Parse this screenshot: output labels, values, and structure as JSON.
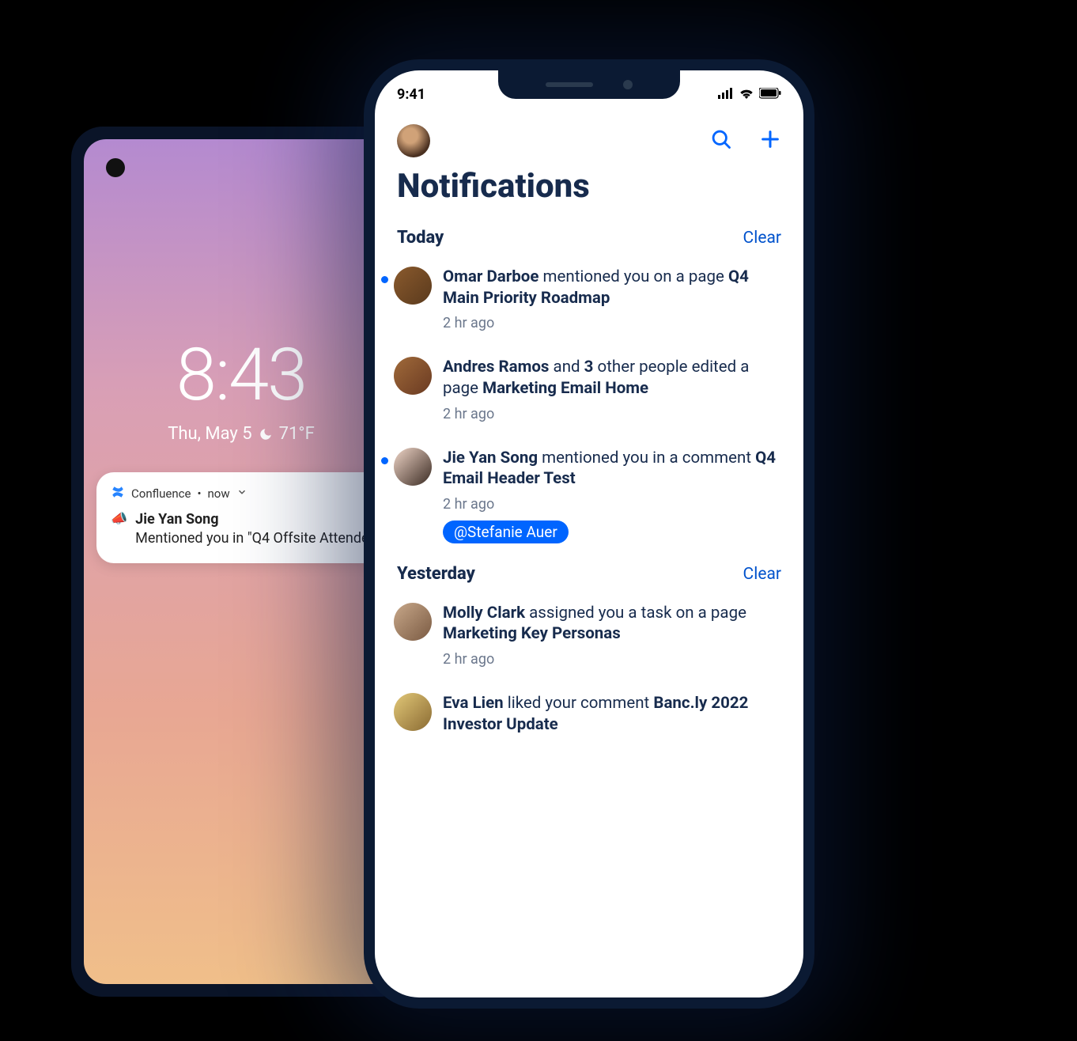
{
  "android": {
    "clock": "8:43",
    "date_text": "Thu, May 5",
    "temp": "71°F",
    "notif": {
      "app": "Confluence",
      "when": "now",
      "person": "Jie Yan Song",
      "body": "Mentioned you in \"Q4 Offsite Attende"
    }
  },
  "iphone": {
    "status_time": "9:41",
    "header_title": "Notifications",
    "sections": [
      {
        "title": "Today",
        "clear": "Clear",
        "items": [
          {
            "unread": true,
            "actor": "Omar Darboe",
            "action_pre": " mentioned you on a page ",
            "target": "Q4 Main Priority Roadmap",
            "ago": "2 hr ago",
            "avatar_bg": "linear-gradient(135deg,#8a5a2d,#5a3a1d)"
          },
          {
            "unread": false,
            "actor": "Andres Ramos",
            "and_count": "3",
            "action_pre_and": " and ",
            "action_post_and": " other people edited a page ",
            "target": "Marketing Email Home",
            "ago": "2 hr ago",
            "avatar_bg": "linear-gradient(135deg,#a06a3a,#6a3a22)"
          },
          {
            "unread": true,
            "actor": "Jie Yan Song",
            "action_pre": " mentioned you in a comment ",
            "target": "Q4 Email Header Test",
            "ago": "2 hr ago",
            "mention": "@Stefanie Auer",
            "avatar_bg": "linear-gradient(135deg,#f0d6c8,#3a2a22)"
          }
        ]
      },
      {
        "title": "Yesterday",
        "clear": "Clear",
        "items": [
          {
            "unread": false,
            "actor": "Molly Clark",
            "action_pre": " assigned you a task on a page ",
            "target": "Marketing Key Personas",
            "ago": "2 hr ago",
            "avatar_bg": "linear-gradient(135deg,#c8a88a,#7a5a42)"
          },
          {
            "unread": false,
            "actor": "Eva Lien",
            "action_pre": " liked your comment ",
            "target": "Banc.ly 2022 Investor Update",
            "ago": "",
            "avatar_bg": "linear-gradient(135deg,#e2c878,#8a6a32)"
          }
        ]
      }
    ]
  },
  "colors": {
    "primary_blue": "#0065ff",
    "text_dark": "#172b4d"
  }
}
